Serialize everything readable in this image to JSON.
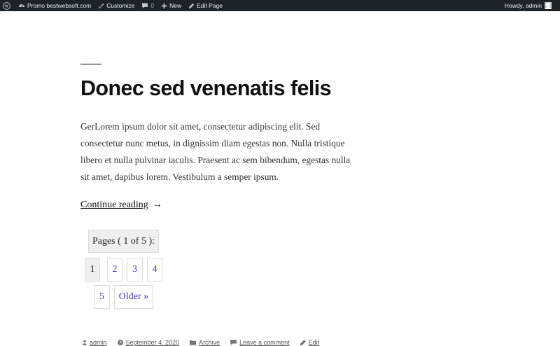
{
  "admin_bar": {
    "site_name": "Promo bestwebsoft.com",
    "customize": "Customize",
    "comments_count": "0",
    "new": "New",
    "edit_page": "Edit Page",
    "howdy": "Howdy, admin"
  },
  "post": {
    "title": "Donec sed venenatis felis",
    "excerpt": "GerLorem ipsum dolor sit amet, consectetur adipiscing elit. Sed consectetur nunc metus, in dignissim diam egestas non. Nulla tristique libero et nulla pulvinar iaculis. Praesent ac sem bibendum, egestas nulla sit amet, dapibus lorem. Vestibulum a semper ipsum.",
    "continue_reading": "Continue reading",
    "arrow": "→"
  },
  "pagination": {
    "label": "Pages ( 1 of 5 ):",
    "current": "1",
    "pages": [
      "2",
      "3",
      "4",
      "5"
    ],
    "older": "Older »"
  },
  "meta": {
    "author": "admin",
    "date": "September 4, 2020",
    "category": "Archive",
    "comment": "Leave a comment",
    "edit": "Edit"
  }
}
